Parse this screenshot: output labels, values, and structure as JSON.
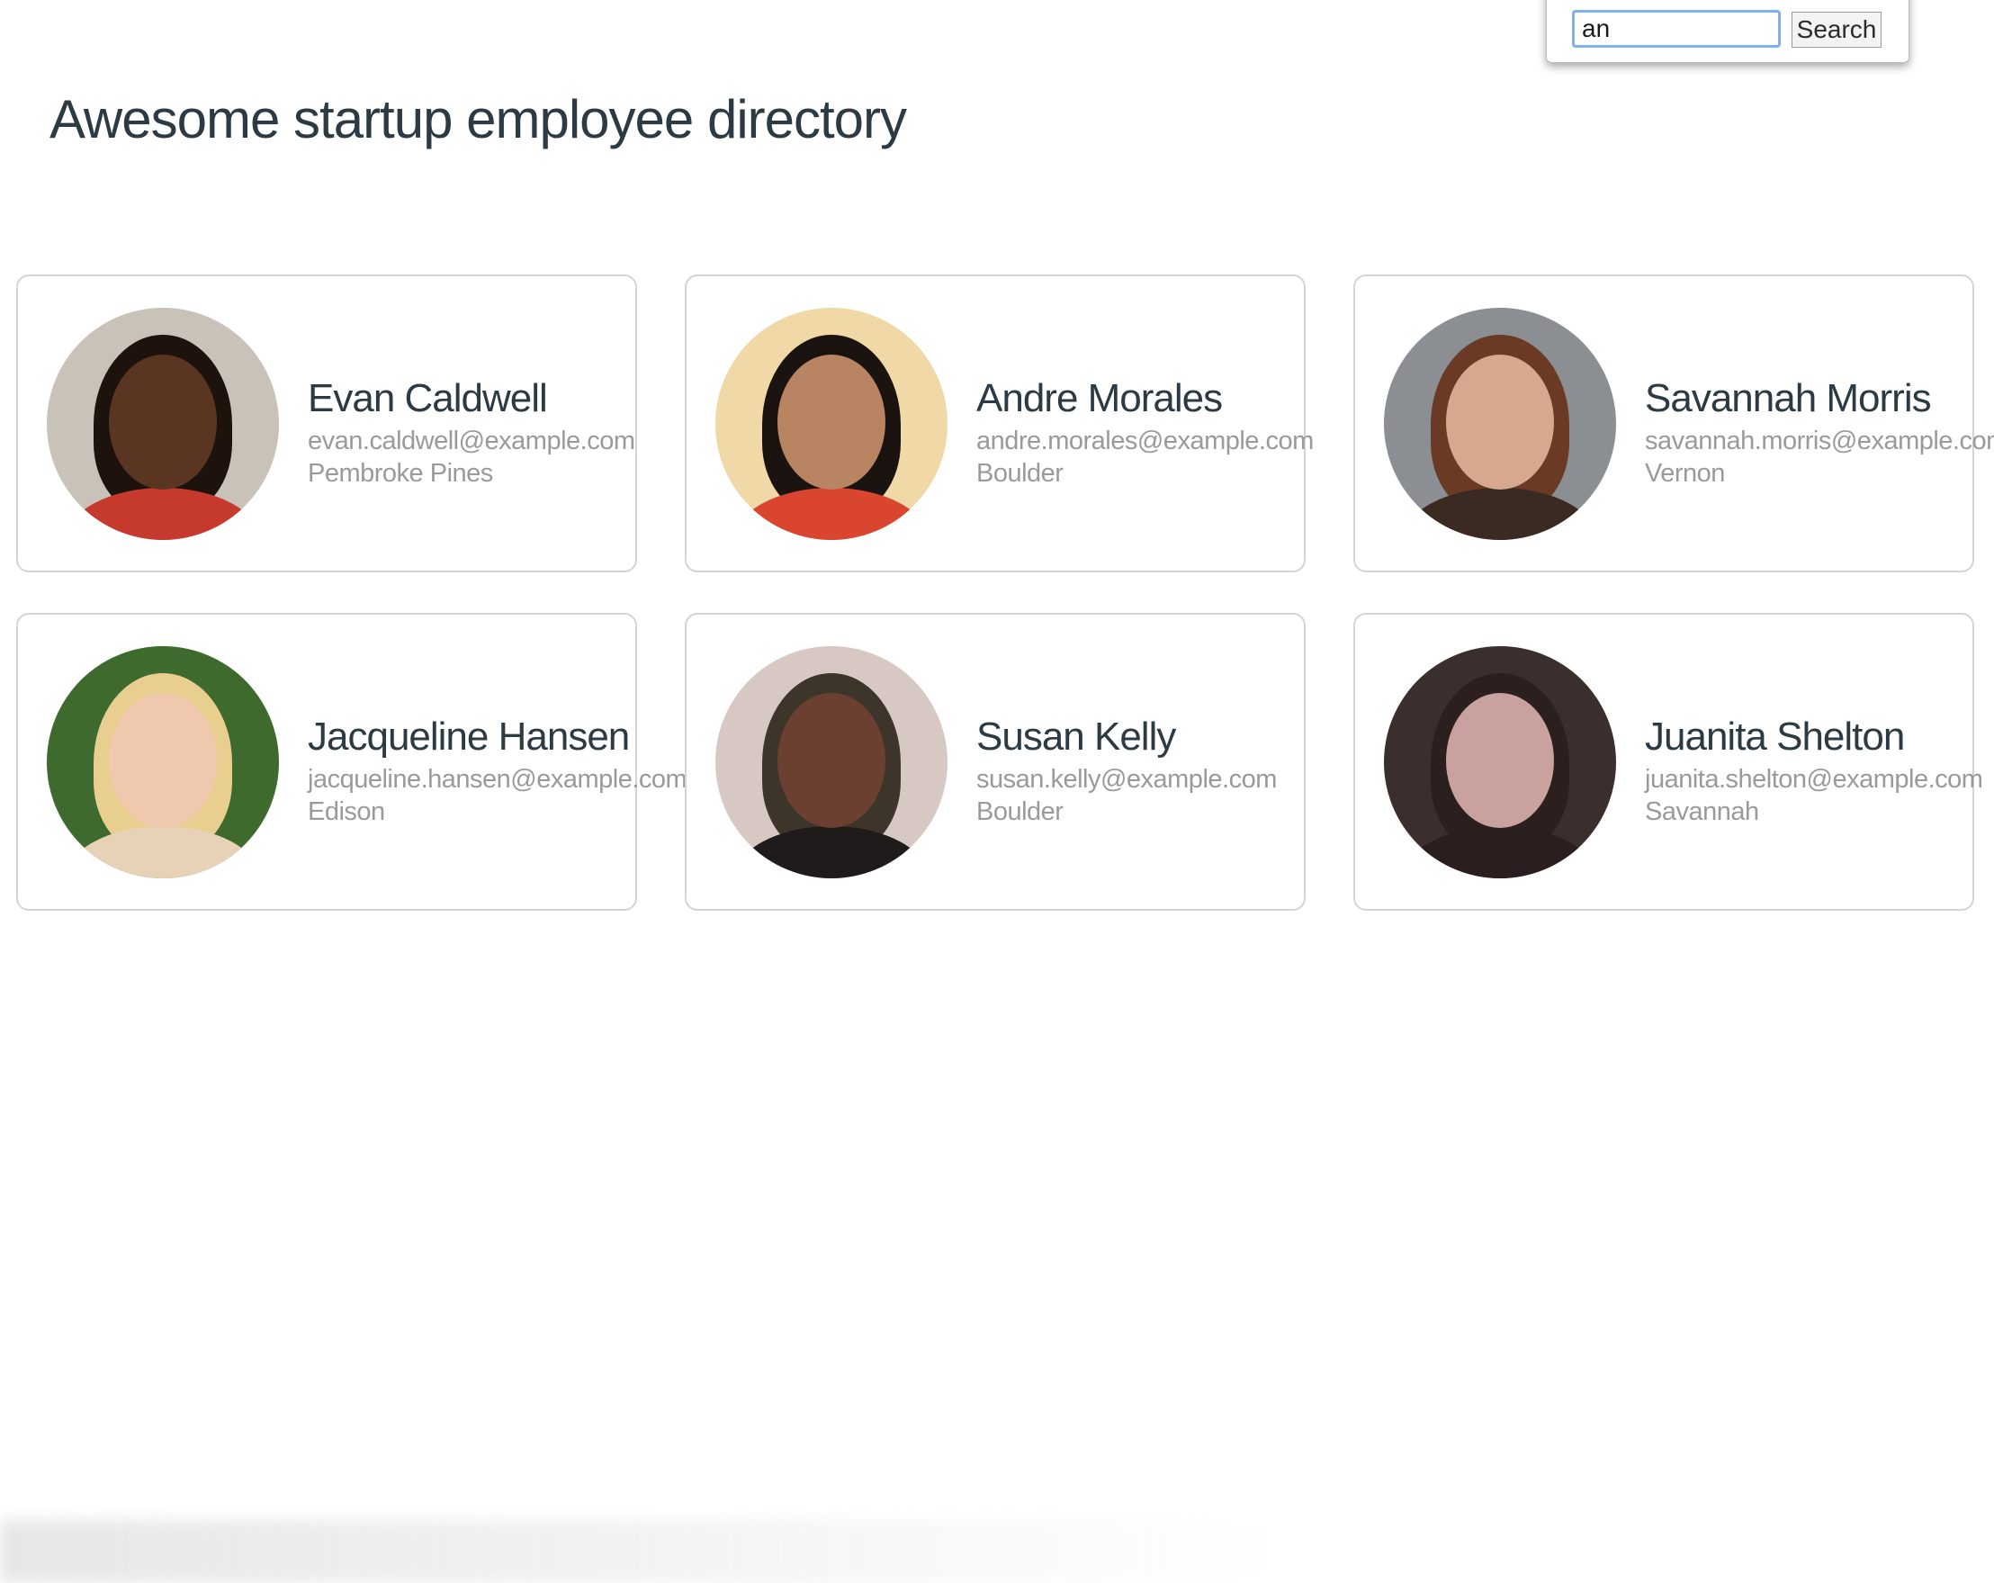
{
  "search": {
    "value": "an",
    "button_label": "Search"
  },
  "page_title": "Awesome startup employee directory",
  "employees": [
    {
      "name": "Evan Caldwell",
      "email": "evan.caldwell@example.com",
      "city": "Pembroke Pines",
      "avatar_bg": "#c9c2b8",
      "skin": "#5a3522",
      "hair": "#1d120c",
      "shirt": "#c63a2e"
    },
    {
      "name": "Andre Morales",
      "email": "andre.morales@example.com",
      "city": "Boulder",
      "avatar_bg": "#f0d9a6",
      "skin": "#b98462",
      "hair": "#1a1310",
      "shirt": "#d9452f"
    },
    {
      "name": "Savannah Morris",
      "email": "savannah.morris@example.com",
      "city": "Vernon",
      "avatar_bg": "#8b8f93",
      "skin": "#d6a88e",
      "hair": "#6a3a24",
      "shirt": "#3b2a22"
    },
    {
      "name": "Jacqueline Hansen",
      "email": "jacqueline.hansen@example.com",
      "city": "Edison",
      "avatar_bg": "#3f6a2e",
      "skin": "#f0c8ae",
      "hair": "#e9cf8f",
      "shirt": "#e7d2b8"
    },
    {
      "name": "Susan Kelly",
      "email": "susan.kelly@example.com",
      "city": "Boulder",
      "avatar_bg": "#d8c8c4",
      "skin": "#6b4030",
      "hair": "#3e352a",
      "shirt": "#1f1b1b"
    },
    {
      "name": "Juanita Shelton",
      "email": "juanita.shelton@example.com",
      "city": "Savannah",
      "avatar_bg": "#3a2f2d",
      "skin": "#c9a2a0",
      "hair": "#2b201d",
      "shirt": "#2a1f1e"
    }
  ]
}
